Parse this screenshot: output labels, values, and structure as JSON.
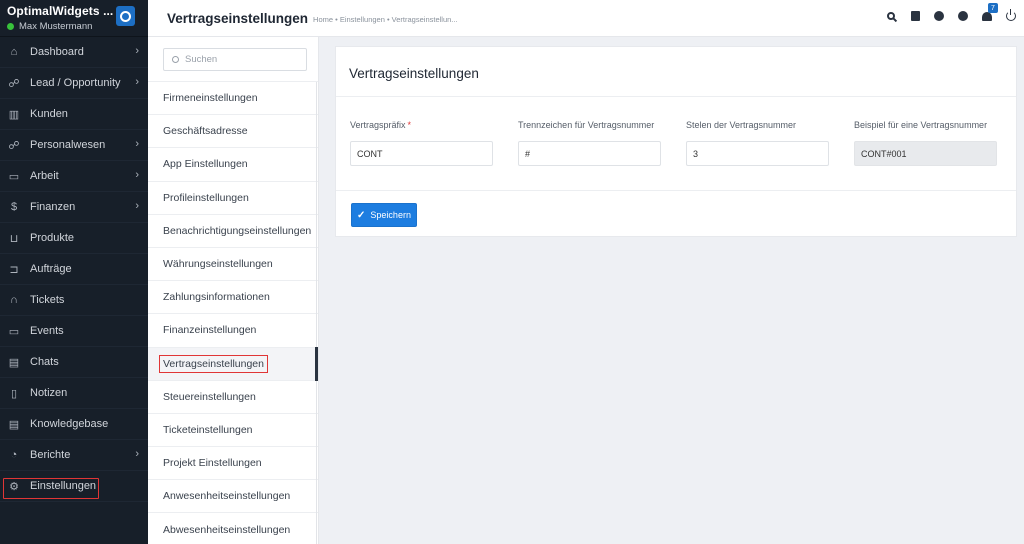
{
  "brand": {
    "app_name": "OptimalWidgets ...",
    "user_name": "Max Mustermann",
    "status_color": "#38c23b"
  },
  "sidebar": {
    "items": [
      {
        "label": "Dashboard",
        "icon": "home-icon",
        "has_arrow": true
      },
      {
        "label": "Lead / Opportunity",
        "icon": "users-icon",
        "has_arrow": true
      },
      {
        "label": "Kunden",
        "icon": "chart-icon",
        "has_arrow": false
      },
      {
        "label": "Personalwesen",
        "icon": "people-icon",
        "has_arrow": true
      },
      {
        "label": "Arbeit",
        "icon": "briefcase-icon",
        "has_arrow": true
      },
      {
        "label": "Finanzen",
        "icon": "dollar-icon",
        "has_arrow": true
      },
      {
        "label": "Produkte",
        "icon": "basket-icon",
        "has_arrow": false
      },
      {
        "label": "Aufträge",
        "icon": "cart-icon",
        "has_arrow": false
      },
      {
        "label": "Tickets",
        "icon": "headset-icon",
        "has_arrow": false
      },
      {
        "label": "Events",
        "icon": "calendar-icon",
        "has_arrow": false
      },
      {
        "label": "Chats",
        "icon": "chat-icon",
        "has_arrow": false
      },
      {
        "label": "Notizen",
        "icon": "clipboard-icon",
        "has_arrow": false
      },
      {
        "label": "Knowledgebase",
        "icon": "book-icon",
        "has_arrow": false
      },
      {
        "label": "Berichte",
        "icon": "pie-icon",
        "has_arrow": true
      },
      {
        "label": "Einstellungen",
        "icon": "gear-icon",
        "has_arrow": false,
        "active": true
      }
    ]
  },
  "header": {
    "title": "Vertragseinstellungen",
    "breadcrumb": "Home • Einstellungen • Vertragseinstellun...",
    "notification_count": "7",
    "accent_color": "#1d6fc4"
  },
  "settings_menu": {
    "search_placeholder": "Suchen",
    "items": [
      "Firmeneinstellungen",
      "Geschäftsadresse",
      "App Einstellungen",
      "Profileinstellungen",
      "Benachrichtigungseinstellungen",
      "Währungseinstellungen",
      "Zahlungsinformationen",
      "Finanzeinstellungen",
      "Vertragseinstellungen",
      "Steuereinstellungen",
      "Ticketeinstellungen",
      "Projekt Einstellungen",
      "Anwesenheitseinstellungen",
      "Abwesenheitseinstellungen"
    ],
    "active_index": 8
  },
  "card": {
    "title": "Vertragseinstellungen",
    "fields": [
      {
        "label": "Vertragspräfix",
        "required_mark": "*",
        "value": "CONT",
        "readonly": false
      },
      {
        "label": "Trennzeichen für Vertragsnummer",
        "required_mark": "",
        "value": "#",
        "readonly": false
      },
      {
        "label": "Stelen der Vertragsnummer",
        "required_mark": "",
        "value": "3",
        "readonly": false
      },
      {
        "label": "Beispiel für eine Vertragsnummer",
        "required_mark": "",
        "value": "CONT#001",
        "readonly": true
      }
    ],
    "save_label": "Speichern",
    "save_color": "#1d7de0"
  }
}
